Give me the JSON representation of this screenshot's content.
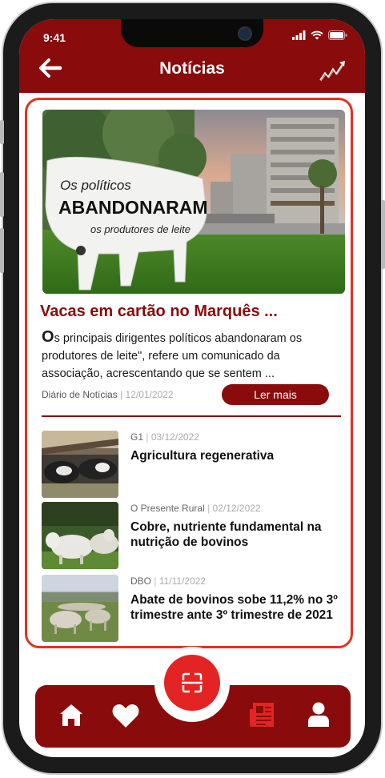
{
  "status": {
    "time": "9:41"
  },
  "header": {
    "title": "Notícias",
    "back_icon": "arrow-left-icon",
    "trend_icon": "trending-chart-icon"
  },
  "featured": {
    "image_text": {
      "line1": "Os políticos",
      "line2": "ABANDONARAM",
      "line3": "os produtores de leite"
    },
    "title": "Vacas em cartão no Marquês ...",
    "description_first": "O",
    "description_rest": "s principais dirigentes políticos abandonaram os produtores de leite\", refere um comunicado da associação, acrescentando que se sentem ...",
    "source": "Diário de Notícias",
    "separator": "|",
    "date": "12/01/2022",
    "read_more": "Ler mais"
  },
  "news": [
    {
      "source": "G1",
      "separator": "|",
      "date": "03/12/2022",
      "headline": "Agricultura regenerativa"
    },
    {
      "source": "O Presente Rural",
      "separator": "|",
      "date": "02/12/2022",
      "headline": "Cobre, nutriente fundamental na nutrição de bovinos"
    },
    {
      "source": "DBO",
      "separator": "|",
      "date": "11/11/2022",
      "headline": "Abate de bovinos sobe 11,2% no 3º trimestre ante 3º trimestre de 2021"
    }
  ],
  "bottom_nav": {
    "items": [
      "home-icon",
      "heart-icon",
      "scan-icon",
      "newspaper-icon",
      "user-icon"
    ],
    "active": "newspaper-icon"
  },
  "colors": {
    "brand": "#8a0b0b",
    "accent": "#e23224",
    "scan": "#e42424",
    "active_nav": "#e42424"
  }
}
